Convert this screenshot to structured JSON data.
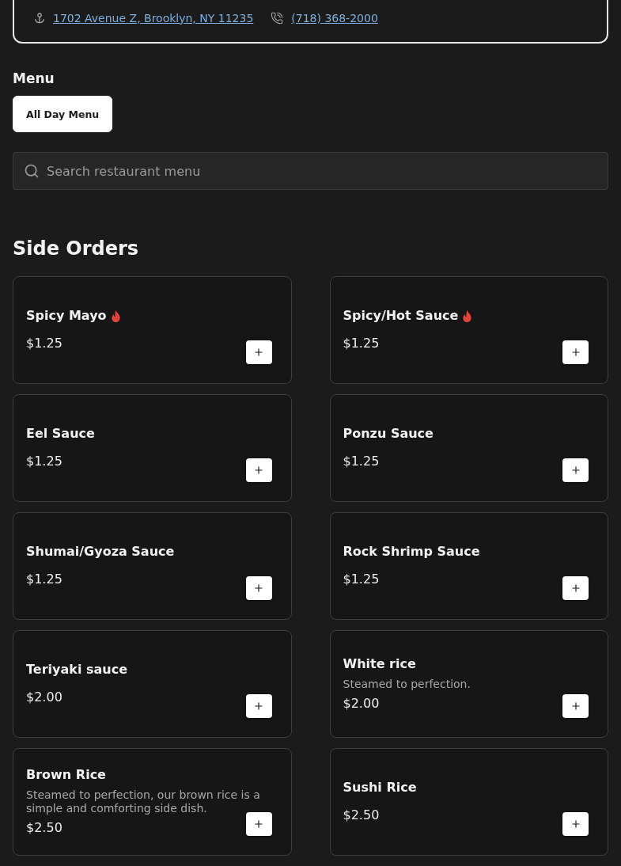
{
  "contact": {
    "address": "1702 Avenue Z, Brooklyn, NY 11235",
    "phone": "(718) 368-2000"
  },
  "menu": {
    "title": "Menu",
    "tabs": [
      {
        "label": "All Day Menu",
        "selected": true
      }
    ]
  },
  "search": {
    "placeholder": "Search restaurant menu"
  },
  "section": {
    "title": "Side Orders",
    "items": [
      {
        "name": "Spicy Mayo",
        "spicy": true,
        "price": "$1.25"
      },
      {
        "name": "Spicy/Hot Sauce",
        "spicy": true,
        "price": "$1.25"
      },
      {
        "name": "Eel Sauce",
        "spicy": false,
        "price": "$1.25"
      },
      {
        "name": "Ponzu Sauce",
        "spicy": false,
        "price": "$1.25"
      },
      {
        "name": "Shumai/Gyoza Sauce",
        "spicy": false,
        "price": "$1.25"
      },
      {
        "name": "Rock Shrimp Sauce",
        "spicy": false,
        "price": "$1.25"
      },
      {
        "name": "Teriyaki sauce",
        "spicy": false,
        "price": "$2.00"
      },
      {
        "name": "White rice",
        "spicy": false,
        "description": "Steamed to perfection.",
        "price": "$2.00"
      },
      {
        "name": "Brown Rice",
        "spicy": false,
        "description": "Steamed to perfection, our brown rice is a simple and comforting side dish.",
        "price": "$2.50"
      },
      {
        "name": "Sushi Rice",
        "spicy": false,
        "price": "$2.50"
      }
    ]
  }
}
